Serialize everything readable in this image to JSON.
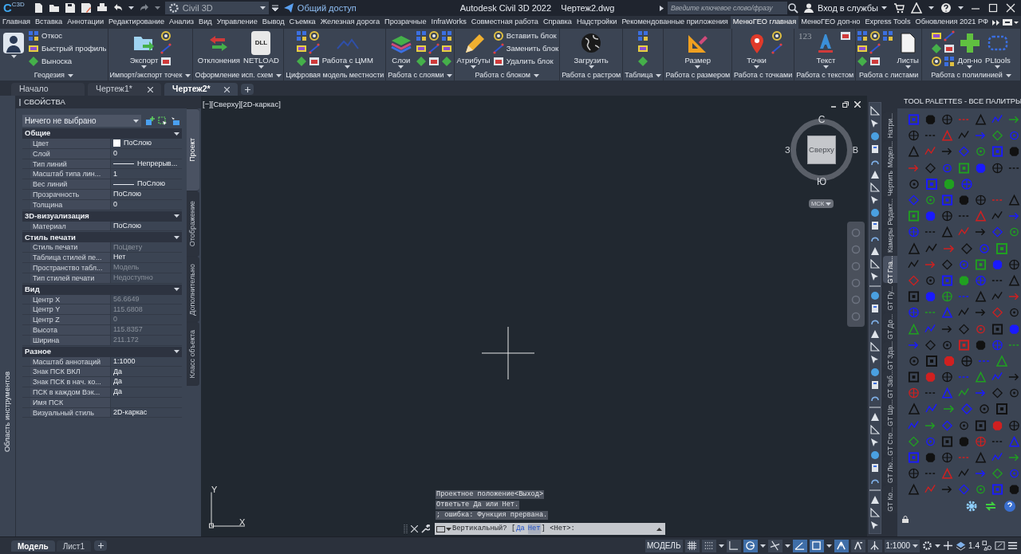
{
  "title_bar": {
    "logo": "C",
    "logo_sub": "C3D",
    "workspace": "Civil 3D",
    "share": "Общий доступ",
    "app_title": "Autodesk Civil 3D 2022",
    "file": "Чертеж2.dwg",
    "search_placeholder": "Введите ключевое слово/фразу",
    "sign_in": "Вход в службы"
  },
  "ribbon_tabs": [
    {
      "label": "Главная",
      "selected": false
    },
    {
      "label": "Вставка",
      "selected": false
    },
    {
      "label": "Аннотации",
      "selected": false
    },
    {
      "label": "Редактирование",
      "selected": false
    },
    {
      "label": "Анализ",
      "selected": false
    },
    {
      "label": "Вид",
      "selected": false
    },
    {
      "label": "Управление",
      "selected": false
    },
    {
      "label": "Вывод",
      "selected": false
    },
    {
      "label": "Съемка",
      "selected": false
    },
    {
      "label": "Железная дорога",
      "selected": false
    },
    {
      "label": "Прозрачные",
      "selected": false
    },
    {
      "label": "InfraWorks",
      "selected": false
    },
    {
      "label": "Совместная работа",
      "selected": false
    },
    {
      "label": "Справка",
      "selected": false
    },
    {
      "label": "Надстройки",
      "selected": false
    },
    {
      "label": "Рекомендованные приложения",
      "selected": false
    },
    {
      "label": "МенюГЕО главная",
      "selected": true
    },
    {
      "label": "МенюГЕО доп-но",
      "selected": false
    },
    {
      "label": "Express Tools",
      "selected": false
    },
    {
      "label": "Обновления 2021 РФ",
      "selected": false
    }
  ],
  "ribbon_panels": [
    {
      "title": "Геодезия",
      "menu": true,
      "items": [
        {
          "kind": "large",
          "dropdown": true
        },
        {
          "kind": "small",
          "label": "Откос"
        },
        {
          "kind": "small",
          "label": "Быстрый профиль"
        },
        {
          "kind": "small",
          "label": "Выноска"
        }
      ]
    },
    {
      "title": "Импорт/экспорт точек",
      "menu": true,
      "items": [
        {
          "kind": "large",
          "label": "Экспорт",
          "dropdown": true
        },
        {
          "kind": "icon"
        },
        {
          "kind": "icon"
        },
        {
          "kind": "icon"
        }
      ]
    },
    {
      "title": "Оформление исп. схем",
      "menu": true,
      "items": [
        {
          "kind": "large",
          "label": "Отклонения",
          "dropdown": false
        },
        {
          "kind": "large",
          "label": "NETLOAD",
          "dropdown": true,
          "icon_text": "DLL"
        }
      ]
    },
    {
      "title": "Цифровая модель местности",
      "menu": false,
      "items": [
        {
          "kind": "icon"
        },
        {
          "kind": "icon"
        },
        {
          "kind": "icon"
        },
        {
          "kind": "icon"
        },
        {
          "kind": "icon"
        },
        {
          "kind": "icon"
        },
        {
          "kind": "large",
          "label": "Работа с ЦММ",
          "dropdown": true
        }
      ]
    },
    {
      "title": "Работа с слоями",
      "menu": true,
      "items": [
        {
          "kind": "large",
          "label": "Слои",
          "dropdown": true
        },
        {
          "kind": "icon"
        },
        {
          "kind": "icon"
        },
        {
          "kind": "icon"
        },
        {
          "kind": "icon"
        },
        {
          "kind": "icon"
        },
        {
          "kind": "icon"
        },
        {
          "kind": "icon"
        },
        {
          "kind": "icon"
        },
        {
          "kind": "icon"
        }
      ]
    },
    {
      "title": "Работа с блоком",
      "menu": true,
      "items": [
        {
          "kind": "large",
          "label": "Атрибуты",
          "dropdown": true
        },
        {
          "kind": "small",
          "label": "Вставить блок"
        },
        {
          "kind": "small",
          "label": "Заменить блок"
        },
        {
          "kind": "small",
          "label": "Удалить блок"
        }
      ]
    },
    {
      "title": "Работа с растром",
      "menu": false,
      "items": [
        {
          "kind": "large",
          "label": "Загрузить",
          "dropdown": true
        }
      ]
    },
    {
      "title": "Таблица",
      "menu": true,
      "items": [
        {
          "kind": "icon"
        },
        {
          "kind": "icon"
        },
        {
          "kind": "icon"
        }
      ]
    },
    {
      "title": "Работа с размером",
      "menu": false,
      "items": [
        {
          "kind": "large",
          "label": "Размер",
          "dropdown": true
        }
      ]
    },
    {
      "title": "Работа с точками",
      "menu": false,
      "items": [
        {
          "kind": "large",
          "label": "Точки",
          "dropdown": true
        },
        {
          "kind": "icon"
        },
        {
          "kind": "icon"
        }
      ]
    },
    {
      "title": "Работа с текстом",
      "menu": false,
      "items": [
        {
          "kind": "icon_text",
          "text": "123"
        },
        {
          "kind": "large",
          "label": "Текст",
          "dropdown": true
        },
        {
          "kind": "icon"
        }
      ]
    },
    {
      "title": "Работа с листами",
      "menu": false,
      "items": [
        {
          "kind": "icon"
        },
        {
          "kind": "icon"
        },
        {
          "kind": "icon"
        },
        {
          "kind": "icon"
        },
        {
          "kind": "icon"
        },
        {
          "kind": "icon"
        },
        {
          "kind": "icon"
        },
        {
          "kind": "large",
          "label": "Листы",
          "dropdown": true
        }
      ]
    },
    {
      "title": "Работа с полилинией",
      "menu": true,
      "items": [
        {
          "kind": "icon"
        },
        {
          "kind": "icon"
        },
        {
          "kind": "icon"
        },
        {
          "kind": "icon"
        },
        {
          "kind": "icon"
        },
        {
          "kind": "icon"
        },
        {
          "kind": "large",
          "label": "Доп-но",
          "dropdown": true
        },
        {
          "kind": "large",
          "label": "PLtools",
          "dropdown": true
        }
      ]
    }
  ],
  "doc_tabs": [
    {
      "label": "Начало",
      "selected": false,
      "closable": false
    },
    {
      "label": "Чертеж1*",
      "selected": false,
      "closable": true
    },
    {
      "label": "Чертеж2*",
      "selected": true,
      "closable": true
    }
  ],
  "tool_strip": {
    "label": "Область инструментов"
  },
  "properties": {
    "title": "СВОЙСТВА",
    "selection": "Ничего не выбрано",
    "sections": [
      {
        "title": "Общие",
        "rows": [
          {
            "label": "Цвет",
            "value": "ПоСлою",
            "kind": "color",
            "readonly": false
          },
          {
            "label": "Слой",
            "value": "0",
            "kind": "text",
            "readonly": false
          },
          {
            "label": "Тип линий",
            "value": "Непрерыв...",
            "kind": "linetype",
            "readonly": false
          },
          {
            "label": "Масштаб типа лин...",
            "value": "1",
            "kind": "text",
            "readonly": false
          },
          {
            "label": "Вес линий",
            "value": "ПоСлою",
            "kind": "linetype",
            "readonly": false
          },
          {
            "label": "Прозрачность",
            "value": "ПоСлою",
            "kind": "text",
            "readonly": false
          },
          {
            "label": "Толщина",
            "value": "0",
            "kind": "text",
            "readonly": false
          }
        ]
      },
      {
        "title": "3D-визуализация",
        "rows": [
          {
            "label": "Материал",
            "value": "ПоСлою",
            "kind": "text",
            "readonly": false
          }
        ]
      },
      {
        "title": "Стиль печати",
        "rows": [
          {
            "label": "Стиль печати",
            "value": "ПоЦвету",
            "kind": "text",
            "readonly": true
          },
          {
            "label": "Таблица стилей пе...",
            "value": "Нет",
            "kind": "text",
            "readonly": false
          },
          {
            "label": "Пространство табл...",
            "value": "Модель",
            "kind": "text",
            "readonly": true
          },
          {
            "label": "Тип стилей печати",
            "value": "Недоступно",
            "kind": "text",
            "readonly": true
          }
        ]
      },
      {
        "title": "Вид",
        "rows": [
          {
            "label": "Центр X",
            "value": "56.6649",
            "kind": "text",
            "readonly": true
          },
          {
            "label": "Центр Y",
            "value": "115.6808",
            "kind": "text",
            "readonly": true
          },
          {
            "label": "Центр Z",
            "value": "0",
            "kind": "text",
            "readonly": true
          },
          {
            "label": "Высота",
            "value": "115.8357",
            "kind": "text",
            "readonly": true
          },
          {
            "label": "Ширина",
            "value": "211.172",
            "kind": "text",
            "readonly": true
          }
        ]
      },
      {
        "title": "Разное",
        "rows": [
          {
            "label": "Масштаб аннотаций",
            "value": "1:1000",
            "kind": "text",
            "readonly": false
          },
          {
            "label": "Знак ПСК ВКЛ",
            "value": "Да",
            "kind": "text",
            "readonly": false
          },
          {
            "label": "Знак ПСК в нач. ко...",
            "value": "Да",
            "kind": "text",
            "readonly": false
          },
          {
            "label": "ПСК в каждом Вэк...",
            "value": "Да",
            "kind": "text",
            "readonly": false
          },
          {
            "label": "Имя ПСК",
            "kind": "text"
          },
          {
            "label": "Визуальный стиль",
            "value": "2D-каркас",
            "kind": "text",
            "readonly": false
          }
        ]
      }
    ],
    "side_tabs": [
      {
        "label": "Проект",
        "selected": true
      },
      {
        "label": "Отображение",
        "selected": false
      },
      {
        "label": "Дополнительно",
        "selected": false
      },
      {
        "label": "Класс объекта",
        "selected": false
      }
    ]
  },
  "viewport": {
    "label": "[−][Сверху][2D-каркас]",
    "viewcube": {
      "face": "Сверху",
      "north": "С",
      "south": "Ю",
      "west": "З",
      "east": "В",
      "ucs": "МСК"
    },
    "ucs_x": "X",
    "ucs_y": "Y",
    "history": [
      "Проектное положение<Выход>",
      "Ответьте Да или Нет.",
      "; ошибка: Функция прервана."
    ],
    "command": [
      {
        "text": "Вертикальный? [",
        "kind": "plain"
      },
      {
        "text": "Да",
        "kind": "option"
      },
      {
        "text": "Нет",
        "kind": "default"
      },
      {
        "text": "] <Нет>:",
        "kind": "plain"
      }
    ]
  },
  "tool_palettes": {
    "title": "TOOL PALETTES - ВСЕ ПАЛИТРЫ",
    "tabs": [
      {
        "label": "Натри...",
        "selected": false
      },
      {
        "label": "Модел...",
        "selected": false
      },
      {
        "label": "Чертить",
        "selected": false
      },
      {
        "label": "Редакт...",
        "selected": false
      },
      {
        "label": "Камеры",
        "selected": false
      },
      {
        "label": "GT Гла...",
        "selected": true
      },
      {
        "label": "GT Пу...",
        "selected": false
      },
      {
        "label": "GT До...",
        "selected": false
      },
      {
        "label": "GT Зда...",
        "selected": false
      },
      {
        "label": "GT Заб...",
        "selected": false
      },
      {
        "label": "GT Шр...",
        "selected": false
      },
      {
        "label": "GT Сто...",
        "selected": false
      },
      {
        "label": "GT Лю...",
        "selected": false
      },
      {
        "label": "GT Ко...",
        "selected": false
      }
    ]
  },
  "layout_tabs": [
    {
      "label": "Модель",
      "selected": true
    },
    {
      "label": "Лист1",
      "selected": false
    }
  ],
  "status_bar": {
    "space": "МОДЕЛЬ",
    "toggles": [
      {
        "on": false,
        "kind": "plain"
      },
      {
        "on": false,
        "kind": "dropdown"
      },
      {
        "on": false,
        "kind": "plain"
      },
      {
        "on": true,
        "kind": "dropdown"
      },
      {
        "on": false,
        "kind": "dropdown"
      },
      {
        "on": true,
        "kind": "plain"
      },
      {
        "on": true,
        "kind": "dropdown"
      },
      {
        "on": true,
        "kind": "plain"
      },
      {
        "on": false,
        "kind": "plain"
      },
      {
        "on": false,
        "kind": "plain"
      }
    ],
    "scale": "1:1000",
    "lineweight": "1.4"
  }
}
